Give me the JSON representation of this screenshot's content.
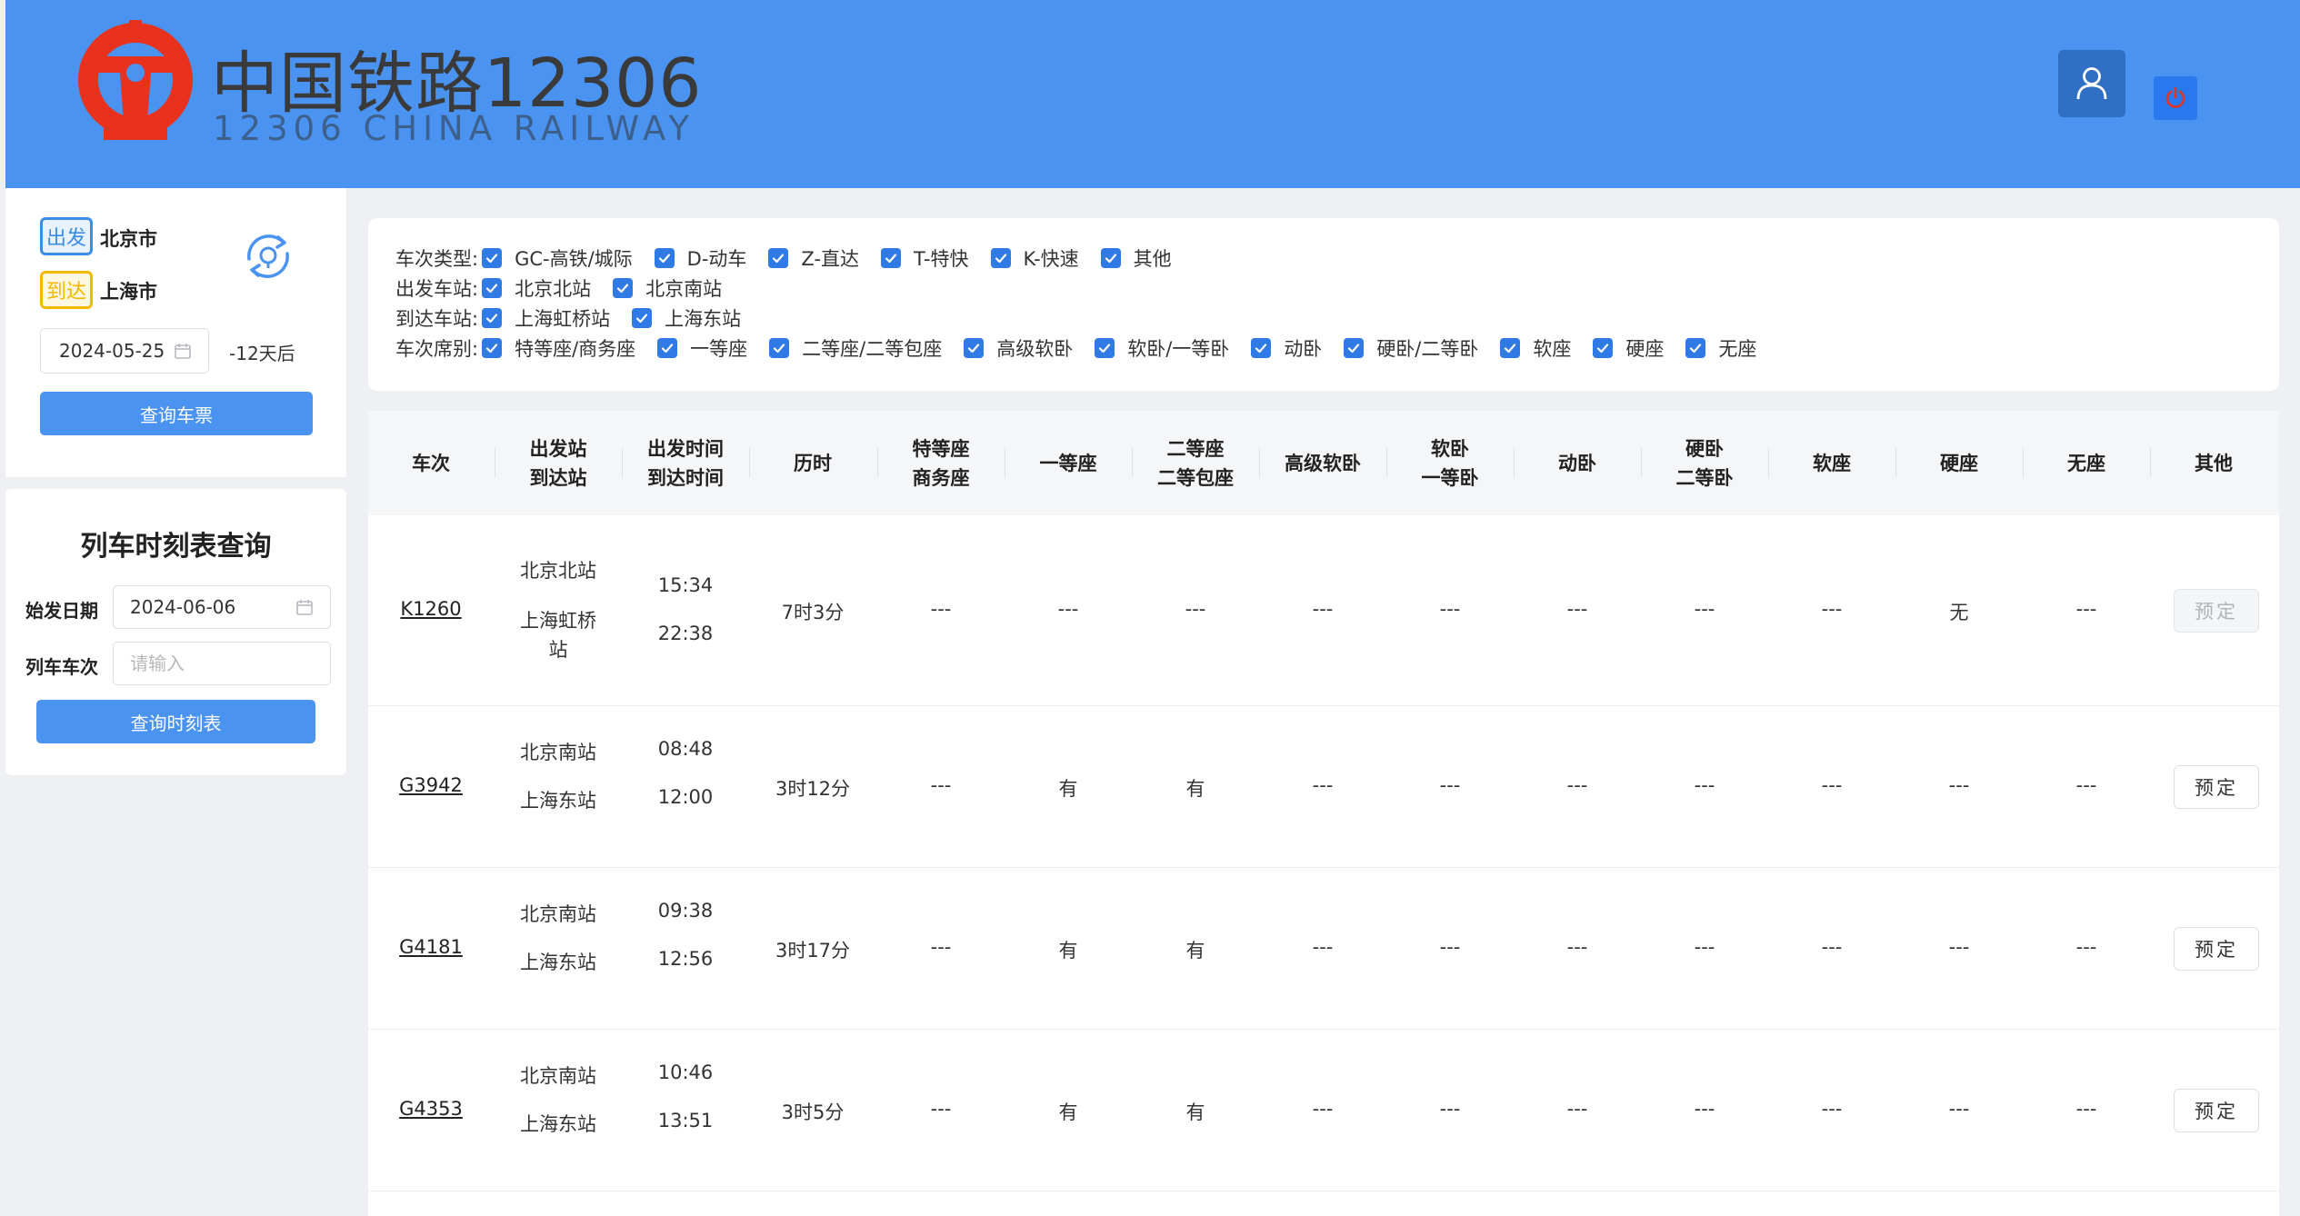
{
  "header": {
    "brand_cn": "中国铁路12306",
    "brand_en": "12306 CHINA RAILWAY",
    "colors": {
      "bar": "#4a93f0",
      "logo": "#e8321e"
    }
  },
  "search": {
    "from_badge": "出发",
    "to_badge": "到达",
    "from_city": "北京市",
    "to_city": "上海市",
    "date": "2024-05-25",
    "days_later": "-12天后",
    "search_button": "查询车票"
  },
  "timetable": {
    "title": "列车时刻表查询",
    "date_label": "始发日期",
    "date_value": "2024-06-06",
    "train_label": "列车车次",
    "train_placeholder": "请输入",
    "button": "查询时刻表"
  },
  "filters": {
    "type_label": "车次类型:",
    "types": [
      "GC-高铁/城际",
      "D-动车",
      "Z-直达",
      "T-特快",
      "K-快速",
      "其他"
    ],
    "from_label": "出发车站:",
    "from_stations": [
      "北京北站",
      "北京南站"
    ],
    "to_label": "到达车站:",
    "to_stations": [
      "上海虹桥站",
      "上海东站"
    ],
    "seat_label": "车次席别:",
    "seats": [
      "特等座/商务座",
      "一等座",
      "二等座/二等包座",
      "高级软卧",
      "软卧/一等卧",
      "动卧",
      "硬卧/二等卧",
      "软座",
      "硬座",
      "无座"
    ]
  },
  "table": {
    "headers": [
      [
        "车次"
      ],
      [
        "出发站",
        "到达站"
      ],
      [
        "出发时间",
        "到达时间"
      ],
      [
        "历时"
      ],
      [
        "特等座",
        "商务座"
      ],
      [
        "一等座"
      ],
      [
        "二等座",
        "二等包座"
      ],
      [
        "高级软卧"
      ],
      [
        "软卧",
        "一等卧"
      ],
      [
        "动卧"
      ],
      [
        "硬卧",
        "二等卧"
      ],
      [
        "软座"
      ],
      [
        "硬座"
      ],
      [
        "无座"
      ],
      [
        "其他"
      ]
    ],
    "rows": [
      {
        "train": "K1260",
        "from": "北京北站",
        "to": "上海虹桥站",
        "depart": "15:34",
        "arrive": "22:38",
        "duration": "7时3分",
        "seats": [
          "---",
          "---",
          "---",
          "---",
          "---",
          "---",
          "---",
          "---",
          "无",
          "---"
        ],
        "book": "预定",
        "book_enabled": false
      },
      {
        "train": "G3942",
        "from": "北京南站",
        "to": "上海东站",
        "depart": "08:48",
        "arrive": "12:00",
        "duration": "3时12分",
        "seats": [
          "---",
          "有",
          "有",
          "---",
          "---",
          "---",
          "---",
          "---",
          "---",
          "---"
        ],
        "book": "预定",
        "book_enabled": true
      },
      {
        "train": "G4181",
        "from": "北京南站",
        "to": "上海东站",
        "depart": "09:38",
        "arrive": "12:56",
        "duration": "3时17分",
        "seats": [
          "---",
          "有",
          "有",
          "---",
          "---",
          "---",
          "---",
          "---",
          "---",
          "---"
        ],
        "book": "预定",
        "book_enabled": true
      },
      {
        "train": "G4353",
        "from": "北京南站",
        "to": "上海东站",
        "depart": "10:46",
        "arrive": "13:51",
        "duration": "3时5分",
        "seats": [
          "---",
          "有",
          "有",
          "---",
          "---",
          "---",
          "---",
          "---",
          "---",
          "---"
        ],
        "book": "预定",
        "book_enabled": true
      }
    ]
  }
}
